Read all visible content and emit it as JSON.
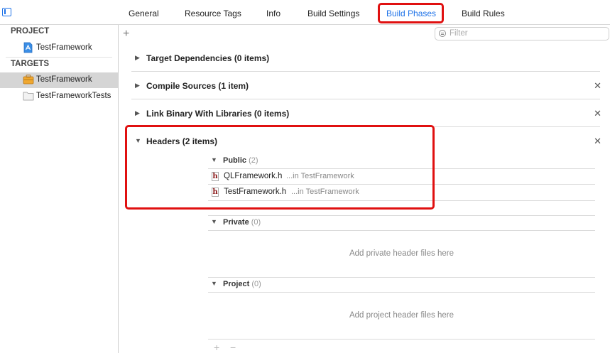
{
  "tabs": [
    {
      "label": "General"
    },
    {
      "label": "Resource Tags"
    },
    {
      "label": "Info"
    },
    {
      "label": "Build Settings"
    },
    {
      "label": "Build Phases",
      "active": true
    },
    {
      "label": "Build Rules"
    }
  ],
  "sidebar": {
    "project_header": "PROJECT",
    "project_item": "TestFramework",
    "targets_header": "TARGETS",
    "targets": [
      {
        "label": "TestFramework",
        "selected": true,
        "icon": "toolbox-icon"
      },
      {
        "label": "TestFrameworkTests",
        "selected": false,
        "icon": "folder-icon"
      }
    ]
  },
  "toolbar": {
    "add_symbol": "+",
    "filter_placeholder": "Filter"
  },
  "phases": [
    {
      "title": "Target Dependencies (0 items)",
      "removable": false
    },
    {
      "title": "Compile Sources (1 item)",
      "removable": true
    },
    {
      "title": "Link Binary With Libraries (0 items)",
      "removable": true
    },
    {
      "title": "Headers (2 items)",
      "removable": true,
      "expanded": true
    }
  ],
  "headers": {
    "public": {
      "name": "Public",
      "count": "(2)",
      "files": [
        {
          "name": "QLFramework.h",
          "location": "...in TestFramework"
        },
        {
          "name": "TestFramework.h",
          "location": "...in TestFramework"
        }
      ]
    },
    "private": {
      "name": "Private",
      "count": "(0)",
      "empty_text": "Add private header files here"
    },
    "project": {
      "name": "Project",
      "count": "(0)",
      "empty_text": "Add project header files here"
    }
  },
  "bottom_controls": {
    "add": "+",
    "remove": "−"
  },
  "colors": {
    "accent": "#1f73e8",
    "highlight": "#e01010",
    "selection": "#d5d5d5"
  }
}
